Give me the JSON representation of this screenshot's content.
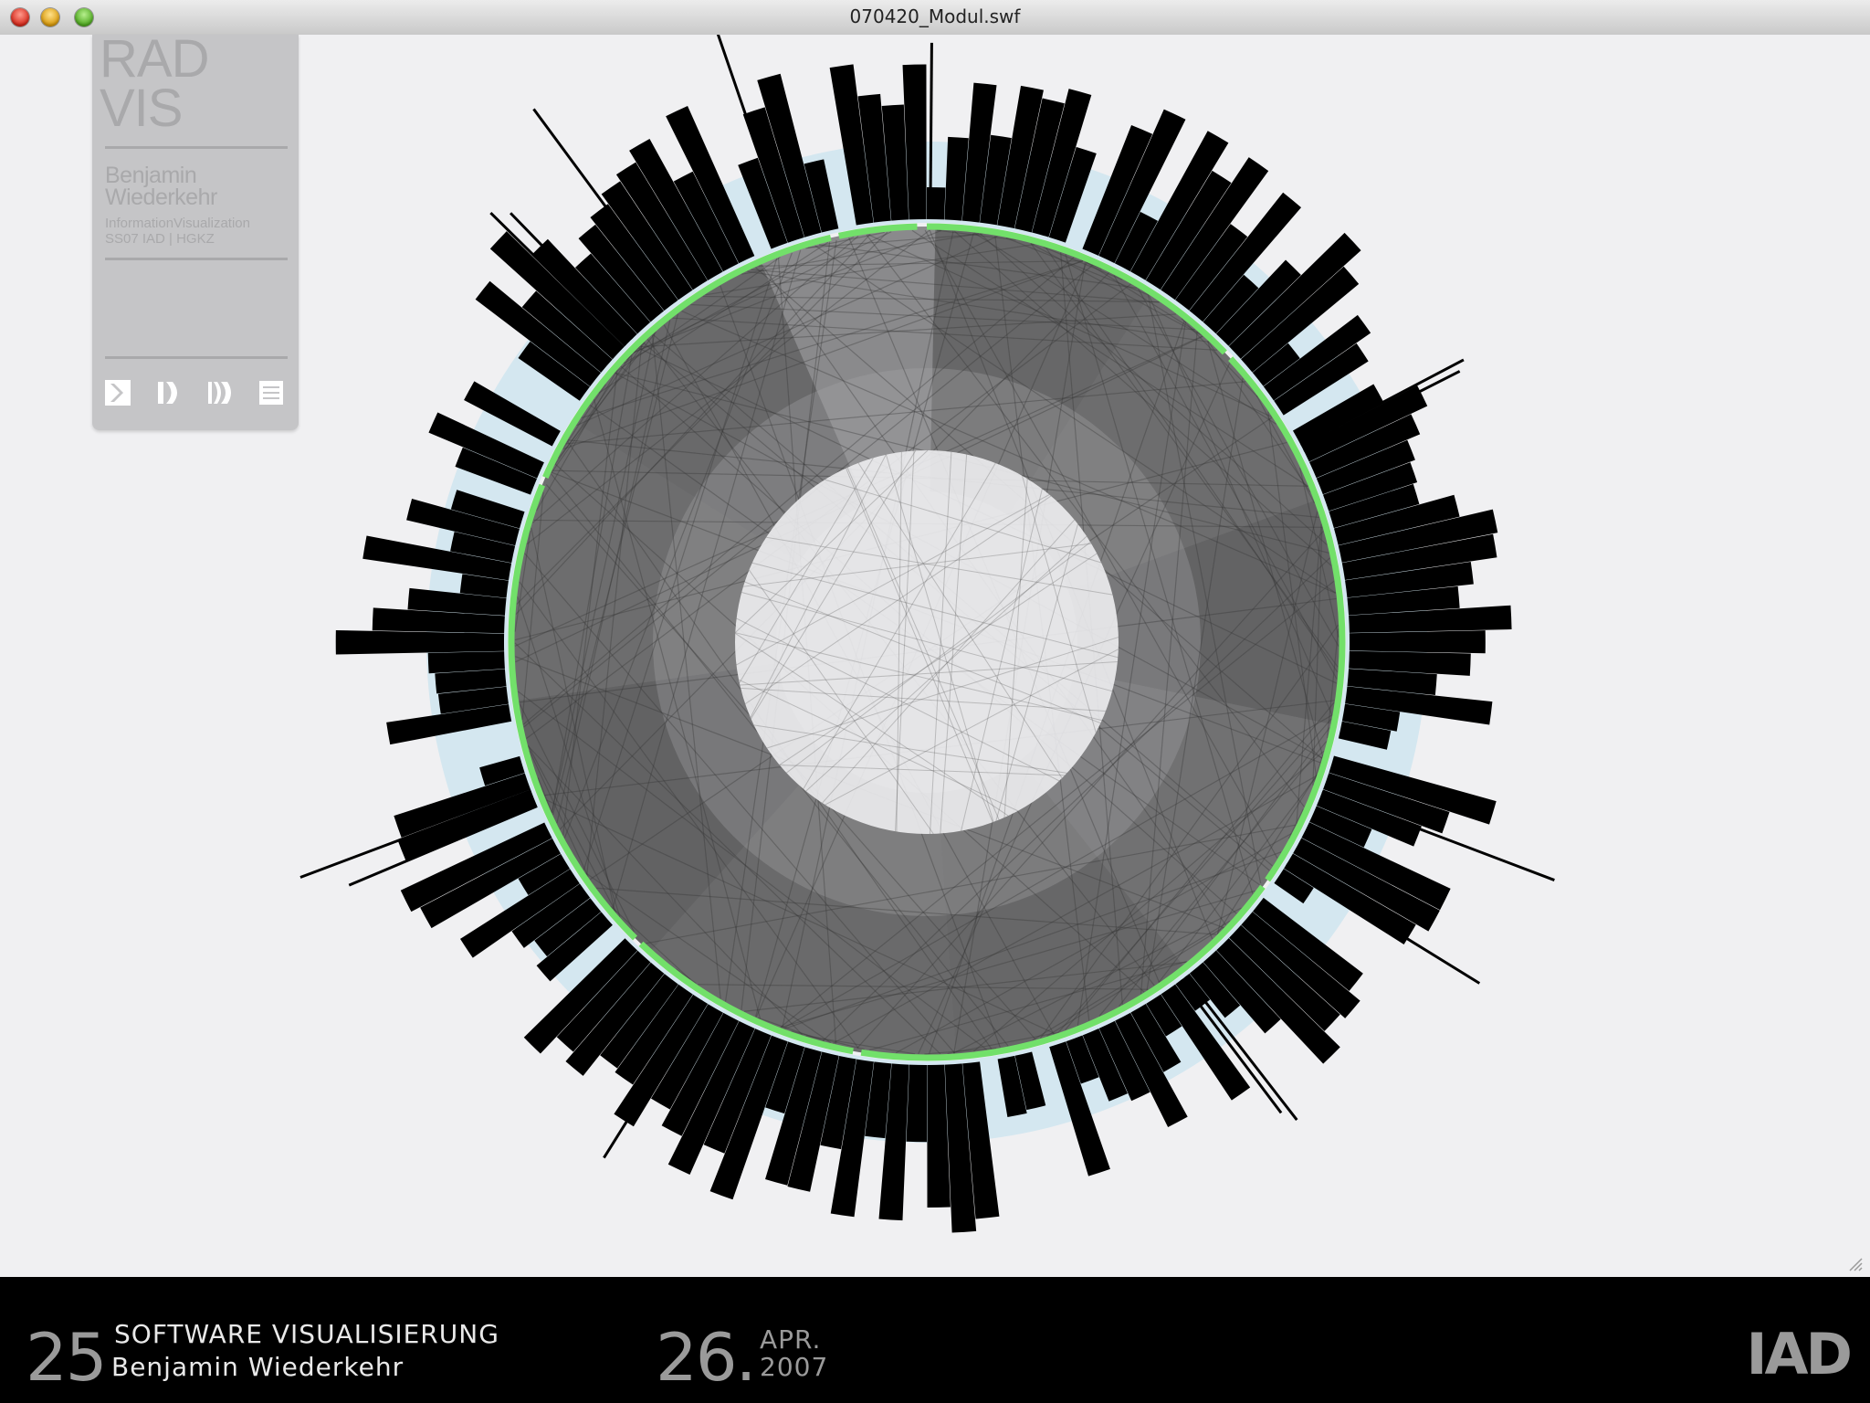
{
  "window": {
    "title": "070420_Modul.swf"
  },
  "panel": {
    "logo_line1": "RAD",
    "logo_line2": "VIS",
    "author_line1": "Benjamin",
    "author_line2": "Wiederkehr",
    "course_line1": "InformationVisualization",
    "course_line2": "SS07 IAD | HGKZ",
    "controls": [
      "play-icon",
      "step-forward-icon",
      "fast-forward-icon",
      "menu-icon"
    ]
  },
  "visualization": {
    "colors": {
      "bars": "#000000",
      "halo": "#d4e7f0",
      "ring": "#72e06a",
      "sectors": "#4a4a4a",
      "inner": "#f0f0f2"
    }
  },
  "footer": {
    "number": "25",
    "title": "SOFTWARE VISUALISIERUNG",
    "author": "Benjamin Wiederkehr",
    "day": "26.",
    "month": "APR.",
    "year": "2007",
    "logo": "IAD"
  }
}
